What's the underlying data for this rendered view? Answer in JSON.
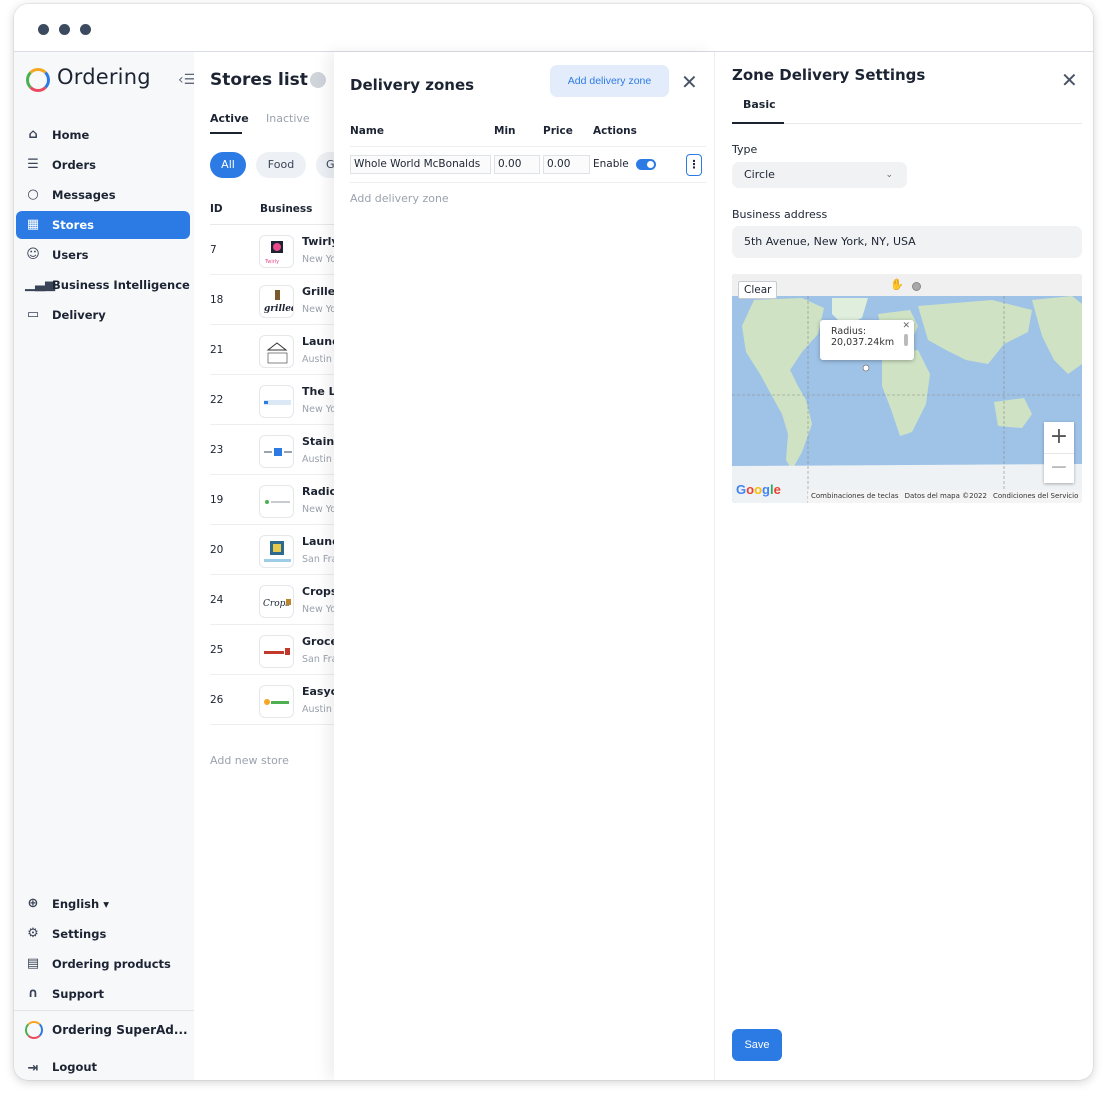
{
  "window": {
    "title_dots": 3
  },
  "sidebar": {
    "brand": "Ordering",
    "items": [
      {
        "label": "Home",
        "icon": "home-icon"
      },
      {
        "label": "Orders",
        "icon": "list-icon"
      },
      {
        "label": "Messages",
        "icon": "chat-icon"
      },
      {
        "label": "Stores",
        "icon": "store-icon",
        "active": true
      },
      {
        "label": "Users",
        "icon": "users-icon"
      },
      {
        "label": "Business Intelligence",
        "icon": "bar-chart-icon"
      },
      {
        "label": "Delivery",
        "icon": "truck-icon"
      }
    ],
    "bottom_items": [
      {
        "label": "English",
        "icon": "globe-icon"
      },
      {
        "label": "Settings",
        "icon": "gear-icon"
      },
      {
        "label": "Ordering products",
        "icon": "window-icon"
      },
      {
        "label": "Support",
        "icon": "headset-icon"
      }
    ],
    "user_name": "Ordering SuperAd...",
    "logout": "Logout"
  },
  "stores": {
    "title": "Stores list",
    "tabs": [
      "Active",
      "Inactive"
    ],
    "chips": [
      "All",
      "Food",
      "G"
    ],
    "columns": [
      "ID",
      "Business"
    ],
    "rows": [
      {
        "id": "7",
        "name": "Twirly",
        "city": "New Yo"
      },
      {
        "id": "18",
        "name": "Grillec",
        "city": "New Yo"
      },
      {
        "id": "21",
        "name": "Laund",
        "city": "Austin"
      },
      {
        "id": "22",
        "name": "The La",
        "city": "New Yo"
      },
      {
        "id": "23",
        "name": "Stainy",
        "city": "Austin"
      },
      {
        "id": "19",
        "name": "Radic",
        "city": "New Yo"
      },
      {
        "id": "20",
        "name": "Laund",
        "city": "San Fra"
      },
      {
        "id": "24",
        "name": "Crops",
        "city": "New Yo"
      },
      {
        "id": "25",
        "name": "Groce",
        "city": "San Fra"
      },
      {
        "id": "26",
        "name": "Easyc",
        "city": "Austin"
      }
    ],
    "add_new": "Add new store"
  },
  "zones": {
    "title": "Delivery zones",
    "add_button": "Add delivery zone",
    "columns": [
      "Name",
      "Min",
      "Price",
      "Actions"
    ],
    "row": {
      "name": "Whole World McBonalds",
      "min": "0.00",
      "price": "0.00",
      "enable": "Enable"
    },
    "add_link": "Add delivery zone"
  },
  "settings": {
    "title": "Zone Delivery Settings",
    "tab": "Basic",
    "type_label": "Type",
    "type_value": "Circle",
    "address_label": "Business address",
    "address_value": "5th Avenue, New York, NY, USA",
    "map": {
      "clear": "Clear",
      "radius_label": "Radius:",
      "radius_value": "20,037.24km",
      "google": "Google",
      "footer": [
        "Combinaciones de teclas",
        "Datos del mapa ©2022",
        "Condiciones del Servicio"
      ]
    },
    "save": "Save"
  },
  "colors": {
    "accent": "#2c7be5",
    "text_dark": "#1c2433",
    "muted": "#9aa2ae",
    "map_water": "#9fc3e7",
    "map_land": "#cfe3c4"
  }
}
